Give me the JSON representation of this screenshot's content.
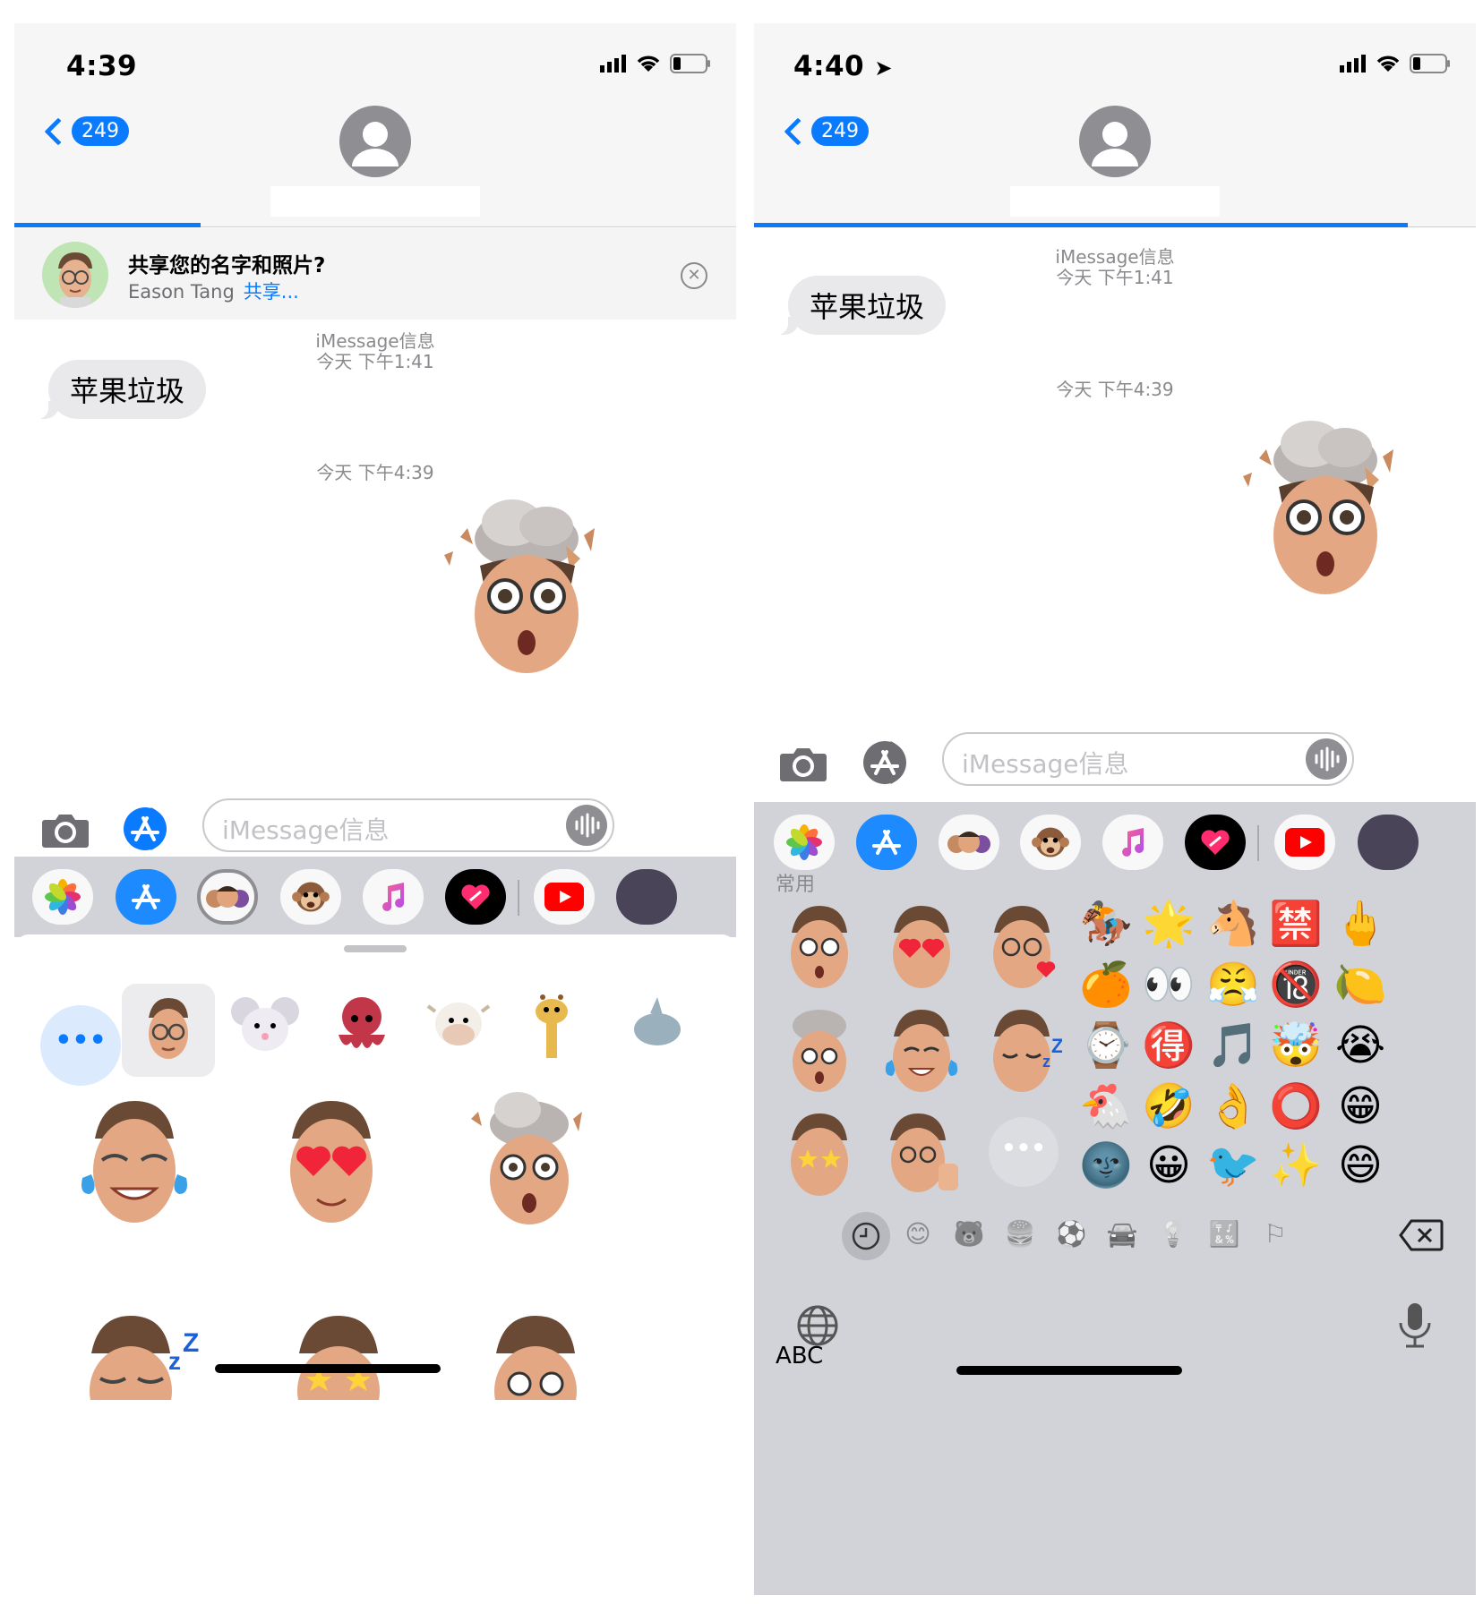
{
  "screens": [
    {
      "time": "4:39",
      "back_badge": "249",
      "share_banner": {
        "title": "共享您的名字和照片?",
        "name": "Eason Tang",
        "link": "共享..."
      },
      "thread": {
        "service": "iMessage信息",
        "first_time": "今天 下午1:41",
        "message": "苹果垃圾",
        "second_time": "今天 下午4:39"
      },
      "compose_placeholder": "iMessage信息",
      "more_label": "•••"
    },
    {
      "time": "4:40",
      "back_badge": "249",
      "thread": {
        "service": "iMessage信息",
        "first_time": "今天 下午1:41",
        "message": "苹果垃圾",
        "second_time": "今天 下午4:39"
      },
      "compose_placeholder": "iMessage信息",
      "keyboard": {
        "section_label": "常用",
        "abc_label": "ABC",
        "emoji_grid": [
          "🏇",
          "🌟",
          "🐴",
          "🈲",
          "🖕",
          "🍊",
          "👀",
          "😤",
          "🔞",
          "🍋",
          "⌚",
          "🉐",
          "🎵",
          "🤯",
          "😭",
          "🐔",
          "🤣",
          "👌",
          "⭕",
          "😁",
          "🌚",
          "😀",
          "🐦",
          "✨",
          "😄"
        ],
        "categories": [
          "😊",
          "🐻",
          "🍔",
          "⚽",
          "🚘",
          "💡",
          "🔣",
          "⚐"
        ]
      }
    }
  ],
  "colors": {
    "accent": "#0a7aff",
    "bubble": "#e9e9eb",
    "drawer": "#d1d3d9",
    "header": "#f6f6f6"
  }
}
